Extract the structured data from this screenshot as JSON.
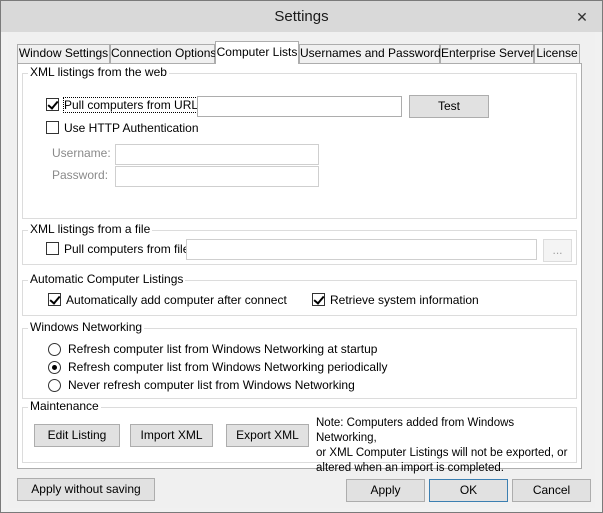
{
  "window": {
    "title": "Settings",
    "close_glyph": "✕"
  },
  "tabs": [
    {
      "label": "Window Settings",
      "active": false
    },
    {
      "label": "Connection Options",
      "active": false
    },
    {
      "label": "Computer Lists",
      "active": true
    },
    {
      "label": "Usernames and Passwords",
      "active": false
    },
    {
      "label": "Enterprise Server",
      "active": false
    },
    {
      "label": "License",
      "active": false
    }
  ],
  "xml_web": {
    "legend": "XML listings from the web",
    "pull_label": "Pull computers from URL:",
    "pull_checked": true,
    "url_value": "",
    "test_label": "Test",
    "http_auth_label": "Use HTTP Authentication",
    "http_auth_checked": false,
    "username_label": "Username:",
    "username_value": "",
    "password_label": "Password:",
    "password_value": ""
  },
  "xml_file": {
    "legend": "XML listings from a file",
    "pull_label": "Pull computers from file:",
    "pull_checked": false,
    "file_value": "",
    "browse_label": "..."
  },
  "auto_listings": {
    "legend": "Automatic Computer Listings",
    "auto_add_label": "Automatically add computer after connect",
    "auto_add_checked": true,
    "retrieve_label": "Retrieve system information",
    "retrieve_checked": true
  },
  "windows_networking": {
    "legend": "Windows Networking",
    "options": [
      {
        "label": "Refresh computer list from Windows Networking at startup",
        "selected": false
      },
      {
        "label": "Refresh computer list from Windows Networking periodically",
        "selected": true
      },
      {
        "label": "Never refresh computer list from Windows Networking",
        "selected": false
      }
    ]
  },
  "maintenance": {
    "legend": "Maintenance",
    "edit_label": "Edit Listing",
    "import_label": "Import XML",
    "export_label": "Export XML",
    "note_line1": "Note: Computers added from Windows Networking,",
    "note_line2": "or XML Computer Listings will not be exported, or",
    "note_line3": "altered when an import is completed."
  },
  "footer": {
    "apply_without_saving": "Apply without saving",
    "apply": "Apply",
    "ok": "OK",
    "cancel": "Cancel"
  }
}
